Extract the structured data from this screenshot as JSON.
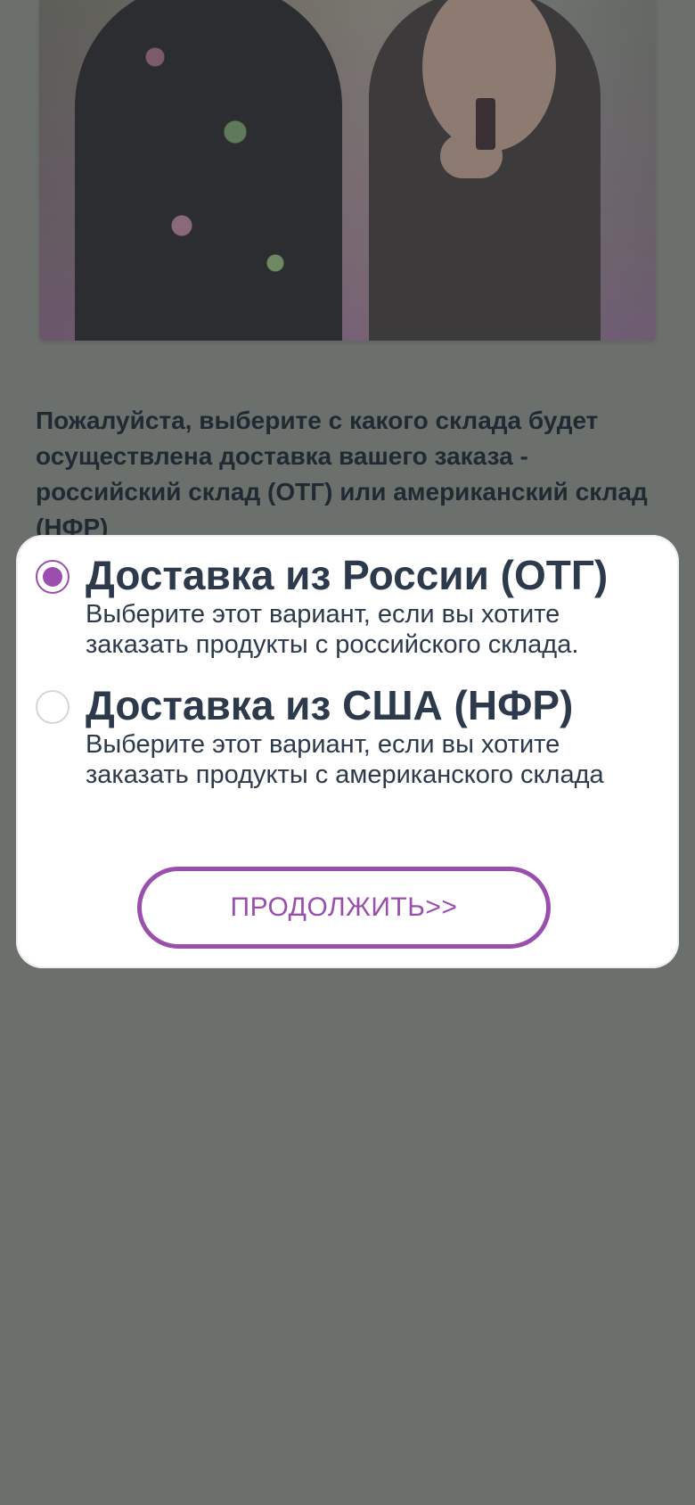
{
  "background": {
    "instruction_text": "Пожалуйста, выберите с какого склада будет осуществлена доставка вашего заказа - российский склад (ОТГ) или американский склад (НФР)"
  },
  "dialog": {
    "options": [
      {
        "title": "Доставка из России (ОТГ)",
        "description": "Выберите этот вариант, если вы хотите заказать продукты с российского склада.",
        "selected": true
      },
      {
        "title": "Доставка из США (НФР)",
        "description": "Выберите этот вариант, если вы хотите заказать продукты с американского склада",
        "selected": false
      }
    ],
    "continue_label": "ПРОДОЛЖИТЬ>>"
  },
  "colors": {
    "overlay": "#6b706d",
    "accent": "#9a4fae",
    "text_dark": "#2c3a4c"
  }
}
